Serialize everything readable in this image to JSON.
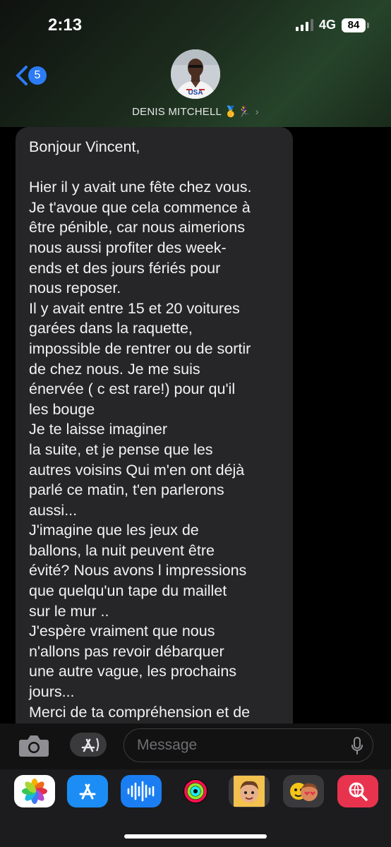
{
  "status_bar": {
    "time": "2:13",
    "network": "4G",
    "battery": "84"
  },
  "header": {
    "back_count": "5",
    "contact_name": "DENIS MITCHELL 🥇🏃‍♀️",
    "chevron": "›"
  },
  "message": {
    "text": "Bonjour Vincent,\n\nHier il y avait une fête chez vous.\nJe t'avoue que cela commence à\nêtre pénible, car nous aimerions\nnous aussi profiter des week-\nends et des jours fériés pour\nnous reposer.\nIl y avait entre 15 et 20 voitures\ngarées dans la raquette,\nimpossible de rentrer ou de sortir\nde chez nous. Je me suis\nénervée ( c est rare!) pour qu'il\nles bouge\nJe te laisse imaginer\nla suite, et je pense que les\nautres voisins Qui m'en ont déjà\nparlé ce matin, t'en parlerons\naussi...\nJ'imagine que les jeux de\nballons, la nuit peuvent être\névité? Nous avons l impressions\nque quelqu'un tape du maillet\nsur le mur ..\nJ'espère vraiment que nous\nn'allons pas revoir débarquer\nune autre vague, les prochains\njours...\nMerci de ta compréhension et de"
  },
  "composer": {
    "placeholder": "Message"
  },
  "avatar": {
    "shirt_text": "USA"
  },
  "apps": [
    "photos-icon",
    "app-store-icon",
    "audio-message-icon",
    "activity-icon",
    "memoji-icon",
    "memoji-sticker-icon",
    "web-search-icon"
  ],
  "colors": {
    "accent": "#2c7cf6",
    "bubble": "#262628",
    "background": "#000000"
  }
}
